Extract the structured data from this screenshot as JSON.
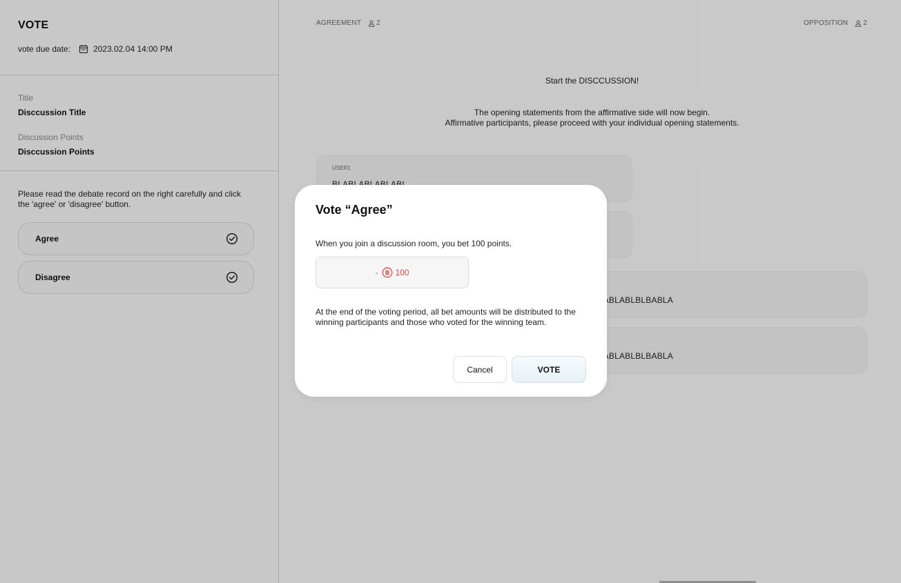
{
  "sidebar": {
    "title": "VOTE",
    "due_label": "vote due date:",
    "due_value": "2023.02.04 14:00 PM",
    "title_label": "Title",
    "title_value": "Disccussion Title",
    "points_label": "Discussion Points",
    "points_value": "Disccussion Points",
    "instruction": "Please read the debate record on the right carefully and click the 'agree' or 'disagree' button.",
    "agree_label": "Agree",
    "disagree_label": "Disagree"
  },
  "main": {
    "agreement_label": "AGREEMENT",
    "agreement_count": "2",
    "opposition_label": "OPPOSITION",
    "opposition_count": "2",
    "start_text": "Start the DISCCUSSION!",
    "statement_line1": "The opening statements from the affirmative side will now begin.",
    "statement_line2": "Affirmative participants, please proceed with your individual opening statements.",
    "messages": [
      {
        "user": "USER1",
        "text": "BLABLABLABLABL"
      },
      {
        "user": "",
        "text": ""
      },
      {
        "user": "",
        "text": "ABLABLBLBABLA"
      },
      {
        "user": "",
        "text": "ABLABLBLBABLA"
      }
    ]
  },
  "modal": {
    "title": "Vote “Agree”",
    "bet_text": "When you join a discussion room, you bet 100 points.",
    "bet_sign": "-",
    "bet_amount": "100",
    "distribution_text": "At the end of the voting period, all bet amounts will be distributed to the winning participants and those who voted for the winning team.",
    "cancel_label": "Cancel",
    "vote_label": "VOTE"
  },
  "colors": {
    "bet_red": "#e24a4a",
    "overlay": "rgba(0,0,0,0.2)"
  },
  "icons": {
    "due": "calendar-icon",
    "vote_option": "check-circle-icon",
    "team_count": "user-icon",
    "bet": "coin-icon"
  }
}
